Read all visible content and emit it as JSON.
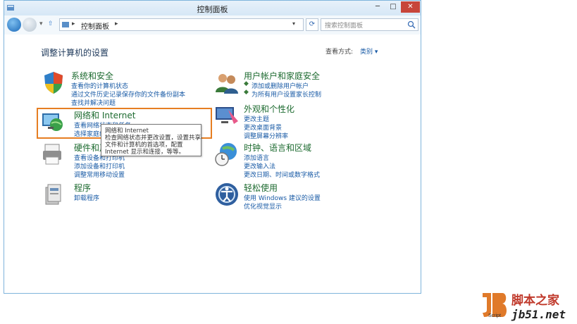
{
  "window": {
    "title": "控制面板"
  },
  "navbar": {
    "address_path": "控制面板",
    "search_placeholder": "搜索控制面板"
  },
  "main": {
    "heading": "调整计算机的设置",
    "view_by_label": "查看方式:",
    "view_by_value": "类别"
  },
  "categories": [
    {
      "title": "系统和安全",
      "links": [
        "查看你的计算机状态",
        "通过文件历史记录保存你的文件备份副本",
        "查找并解决问题"
      ]
    },
    {
      "title": "网络和 Internet",
      "links": [
        "查看网络状态和任务",
        "选择家庭组和共享选项"
      ]
    },
    {
      "title": "硬件和声音",
      "links": [
        "查看设备和打印机",
        "添加设备和打印机",
        "调整常用移动设置"
      ]
    },
    {
      "title": "程序",
      "links": [
        "卸载程序"
      ]
    },
    {
      "title": "用户帐户和家庭安全",
      "links": [
        "添加或删除用户帐户",
        "为所有用户设置家长控制"
      ]
    },
    {
      "title": "外观和个性化",
      "links": [
        "更改主题",
        "更改桌面背景",
        "调整屏幕分辨率"
      ]
    },
    {
      "title": "时钟、语言和区域",
      "links": [
        "添加语言",
        "更改输入法",
        "更改日期、时间或数字格式"
      ]
    },
    {
      "title": "轻松使用",
      "links": [
        "使用 Windows 建议的设置",
        "优化视觉显示"
      ]
    }
  ],
  "tooltip": {
    "line1": "网络和 Internet",
    "line2": "检查网络状态并更改设置，设置共享",
    "line3": "文件和计算机的首选项，配置",
    "line4": "Internet 显示和连接，等等。"
  },
  "watermark": {
    "cn": "脚本之家",
    "url": "jb51.net",
    "small": "Script"
  },
  "colors": {
    "accent": "#1a5ba6",
    "category_title": "#1c6a2f",
    "highlight": "#e67e22",
    "close": "#c7453a"
  }
}
